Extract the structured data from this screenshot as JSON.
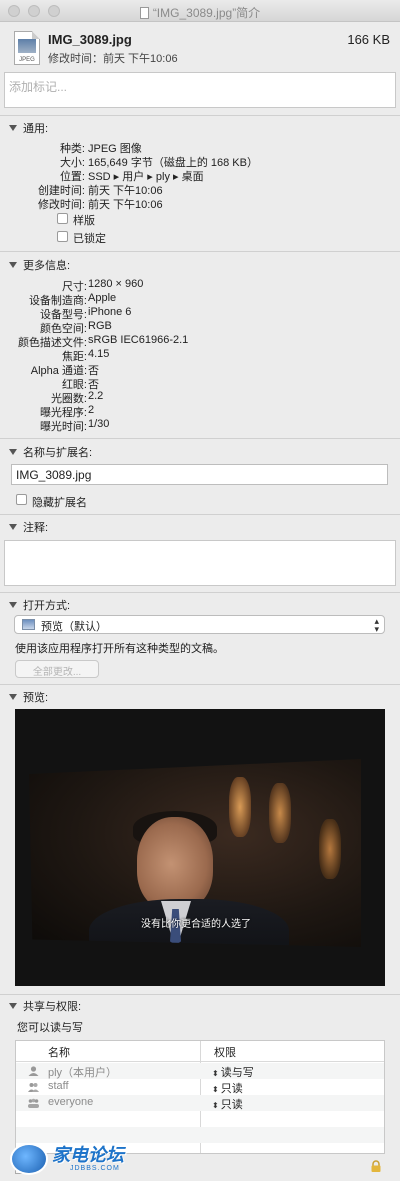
{
  "window": {
    "title": "“IMG_3089.jpg”简介"
  },
  "header": {
    "file_name": "IMG_3089.jpg",
    "file_size": "166 KB",
    "modified": "修改时间：前天 下午10:06",
    "icon_label": "JPEG"
  },
  "tags": {
    "placeholder": "添加标记..."
  },
  "general": {
    "title": "通用:",
    "rows": [
      {
        "k": "种类:",
        "v": "JPEG 图像"
      },
      {
        "k": "大小:",
        "v": "165,649 字节（磁盘上的 168 KB）"
      },
      {
        "k": "位置:",
        "v": "SSD ▸ 用户 ▸ ply ▸ 桌面"
      },
      {
        "k": "创建时间:",
        "v": "前天 下午10:06"
      },
      {
        "k": "修改时间:",
        "v": "前天 下午10:06"
      }
    ],
    "stationery": "样版",
    "locked": "已锁定"
  },
  "more_info": {
    "title": "更多信息:",
    "rows": [
      {
        "k": "尺寸:",
        "v": "1280 × 960"
      },
      {
        "k": "设备制造商:",
        "v": "Apple"
      },
      {
        "k": "设备型号:",
        "v": "iPhone 6"
      },
      {
        "k": "颜色空间:",
        "v": "RGB"
      },
      {
        "k": "颜色描述文件:",
        "v": "sRGB IEC61966-2.1"
      },
      {
        "k": "焦距:",
        "v": "4.15"
      },
      {
        "k": "Alpha 通道:",
        "v": "否"
      },
      {
        "k": "红眼:",
        "v": "否"
      },
      {
        "k": "光圈数:",
        "v": "2.2"
      },
      {
        "k": "曝光程序:",
        "v": "2"
      },
      {
        "k": "曝光时间:",
        "v": "1/30"
      }
    ]
  },
  "name_ext": {
    "title": "名称与扩展名:",
    "value": "IMG_3089.jpg",
    "hide_ext": "隐藏扩展名"
  },
  "comments": {
    "title": "注释:"
  },
  "open_with": {
    "title": "打开方式:",
    "app": "预览（默认）",
    "desc": "使用该应用程序打开所有这种类型的文稿。",
    "change_all": "全部更改..."
  },
  "preview": {
    "title": "预览:",
    "subtitle": "没有比你更合适的人选了"
  },
  "sharing": {
    "title": "共享与权限:",
    "summary": "您可以读与写",
    "col_name": "名称",
    "col_perm": "权限",
    "rows": [
      {
        "name": "ply（本用户）",
        "perm": "读与写"
      },
      {
        "name": "staff",
        "perm": "只读"
      },
      {
        "name": "everyone",
        "perm": "只读"
      }
    ]
  },
  "watermark": {
    "main": "家电论坛",
    "sub": "JDBBS.COM"
  },
  "colors": {
    "accent": "#1d73c9",
    "background": "#ececec"
  }
}
